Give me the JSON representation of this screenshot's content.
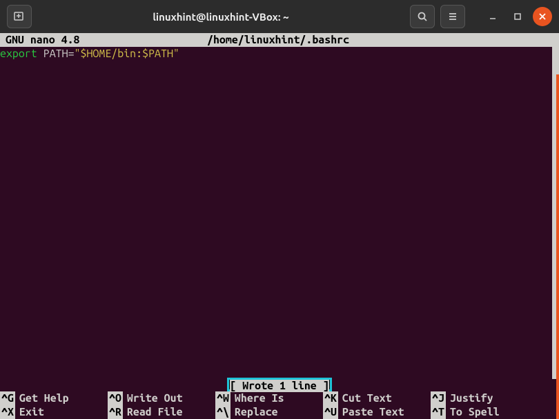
{
  "titlebar": {
    "title": "linuxhint@linuxhint-VBox: ~"
  },
  "nano": {
    "version": "GNU  nano  4.8",
    "filename": "/home/linuxhint/.bashrc"
  },
  "content": {
    "export": "export ",
    "pathvar": "PATH=",
    "value": "\"$HOME/bin:$PATH\""
  },
  "status": {
    "message": "[ Wrote 1 line ]"
  },
  "shortcuts": {
    "row1": [
      {
        "key": "^G",
        "label": "Get Help"
      },
      {
        "key": "^O",
        "label": "Write Out"
      },
      {
        "key": "^W",
        "label": "Where Is"
      },
      {
        "key": "^K",
        "label": "Cut Text"
      },
      {
        "key": "^J",
        "label": "Justify"
      }
    ],
    "row2": [
      {
        "key": "^X",
        "label": "Exit"
      },
      {
        "key": "^R",
        "label": "Read File"
      },
      {
        "key": "^\\",
        "label": "Replace"
      },
      {
        "key": "^U",
        "label": "Paste Text"
      },
      {
        "key": "^T",
        "label": "To Spell"
      }
    ]
  }
}
